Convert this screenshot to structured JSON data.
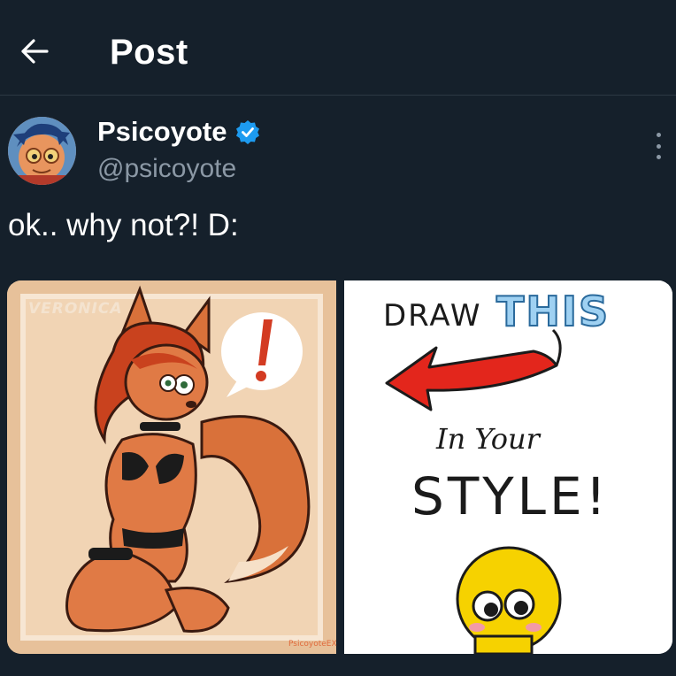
{
  "header": {
    "title": "Post",
    "back_icon": "arrow-left-icon"
  },
  "author": {
    "name": "Psicoyote",
    "handle": "@psicoyote",
    "verified": true,
    "verified_color": "#1d9bf0"
  },
  "post": {
    "text": "ok.. why not?! D:"
  },
  "media": {
    "left_image": {
      "watermark_name": "VERONICA",
      "credit": "PsicoyoteEX"
    },
    "right_image": {
      "line1": "DRAW",
      "line1_highlight": "THIS",
      "line2": "In Your",
      "line3": "STYLE!"
    }
  },
  "colors": {
    "background": "#15202b",
    "divider": "#2c3844",
    "secondary_text": "#8b98a5",
    "accent": "#1d9bf0"
  }
}
